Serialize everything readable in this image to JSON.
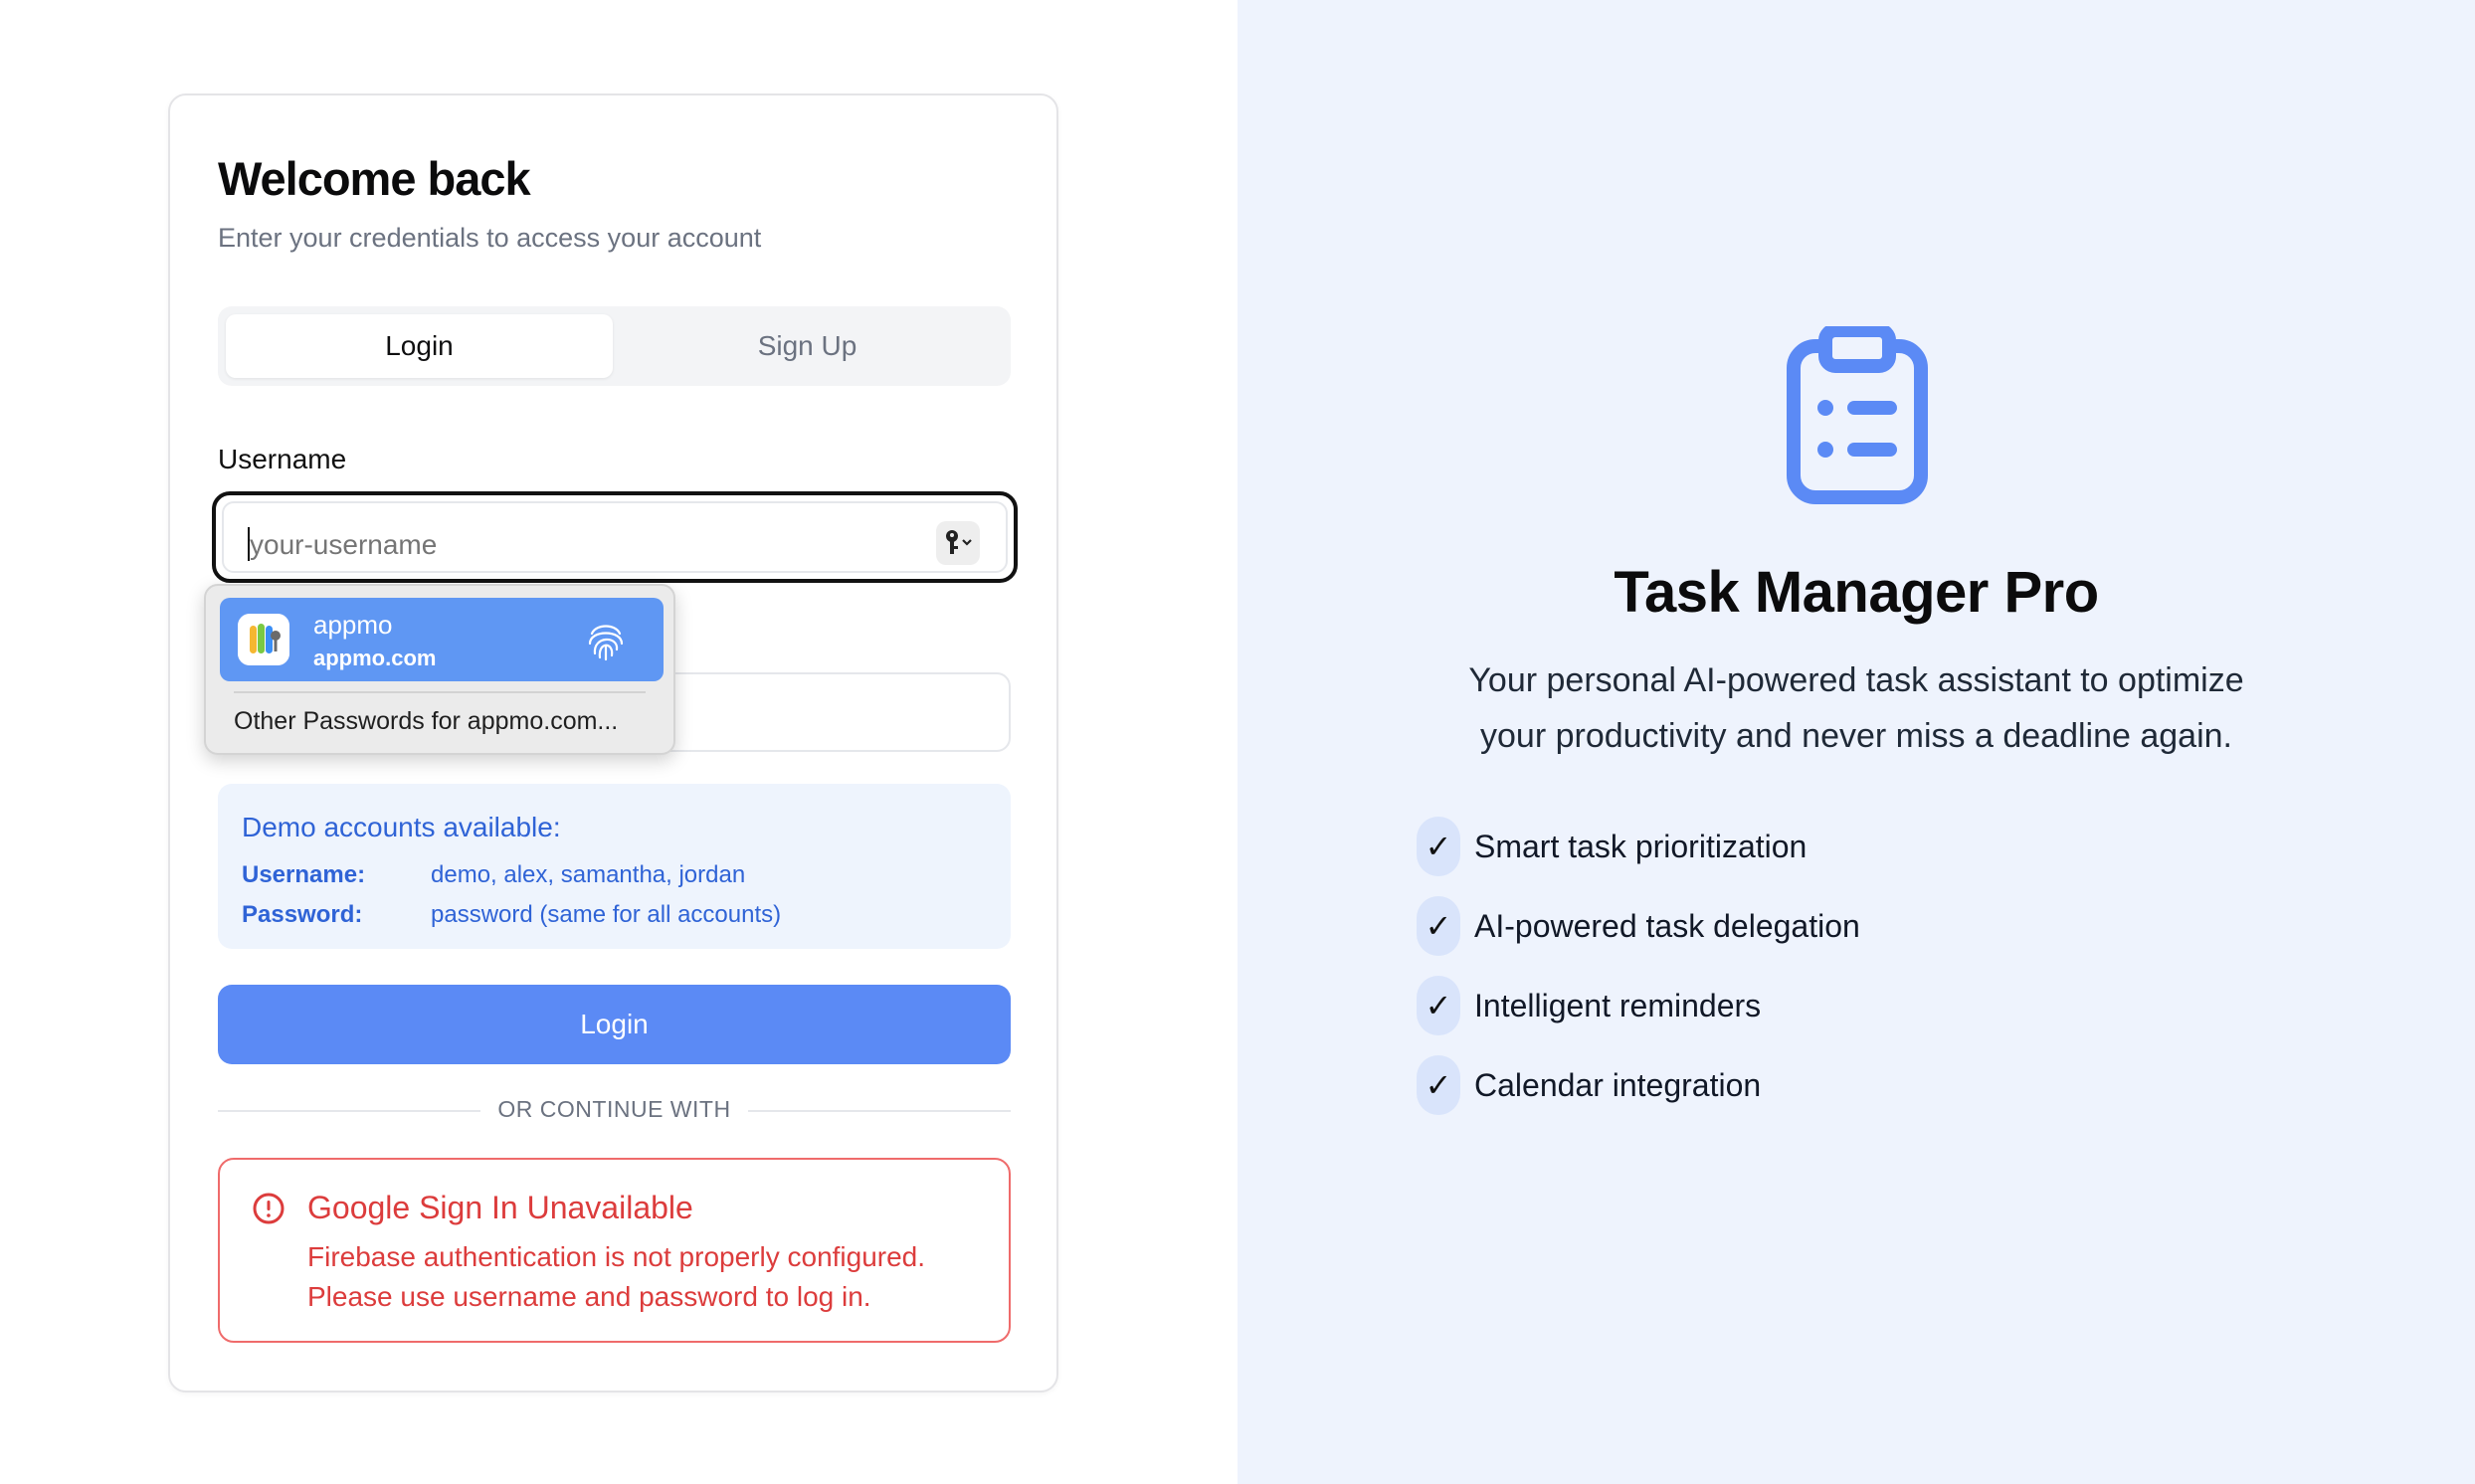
{
  "colors": {
    "accent": "#5b8af5",
    "right_panel_bg": "#eef3fd",
    "error": "#dc3c3c",
    "demo_text": "#2f63d6"
  },
  "login_card": {
    "title": "Welcome back",
    "subtitle": "Enter your credentials to access your account",
    "tabs": [
      {
        "label": "Login",
        "active": true
      },
      {
        "label": "Sign Up",
        "active": false
      }
    ],
    "username_label": "Username",
    "username_placeholder": "your-username",
    "password_value": "",
    "demo": {
      "title": "Demo accounts available:",
      "username_key": "Username:",
      "username_value": "demo, alex, samantha, jordan",
      "password_key": "Password:",
      "password_value": "password (same for all accounts)"
    },
    "login_button": "Login",
    "divider_text": "OR CONTINUE WITH",
    "error": {
      "icon": "alert-circle-icon",
      "title": "Google Sign In Unavailable",
      "message": "Firebase authentication is not properly configured. Please use username and password to log in."
    }
  },
  "autofill_popup": {
    "item_name": "appmo",
    "item_domain": "appmo.com",
    "other_label": "Other Passwords for appmo.com..."
  },
  "promo": {
    "icon": "clipboard-list-icon",
    "title": "Task Manager Pro",
    "description": "Your personal AI-powered task assistant to optimize your productivity and never miss a deadline again.",
    "features": [
      "Smart task prioritization",
      "AI-powered task delegation",
      "Intelligent reminders",
      "Calendar integration"
    ],
    "check_glyph": "✓"
  }
}
